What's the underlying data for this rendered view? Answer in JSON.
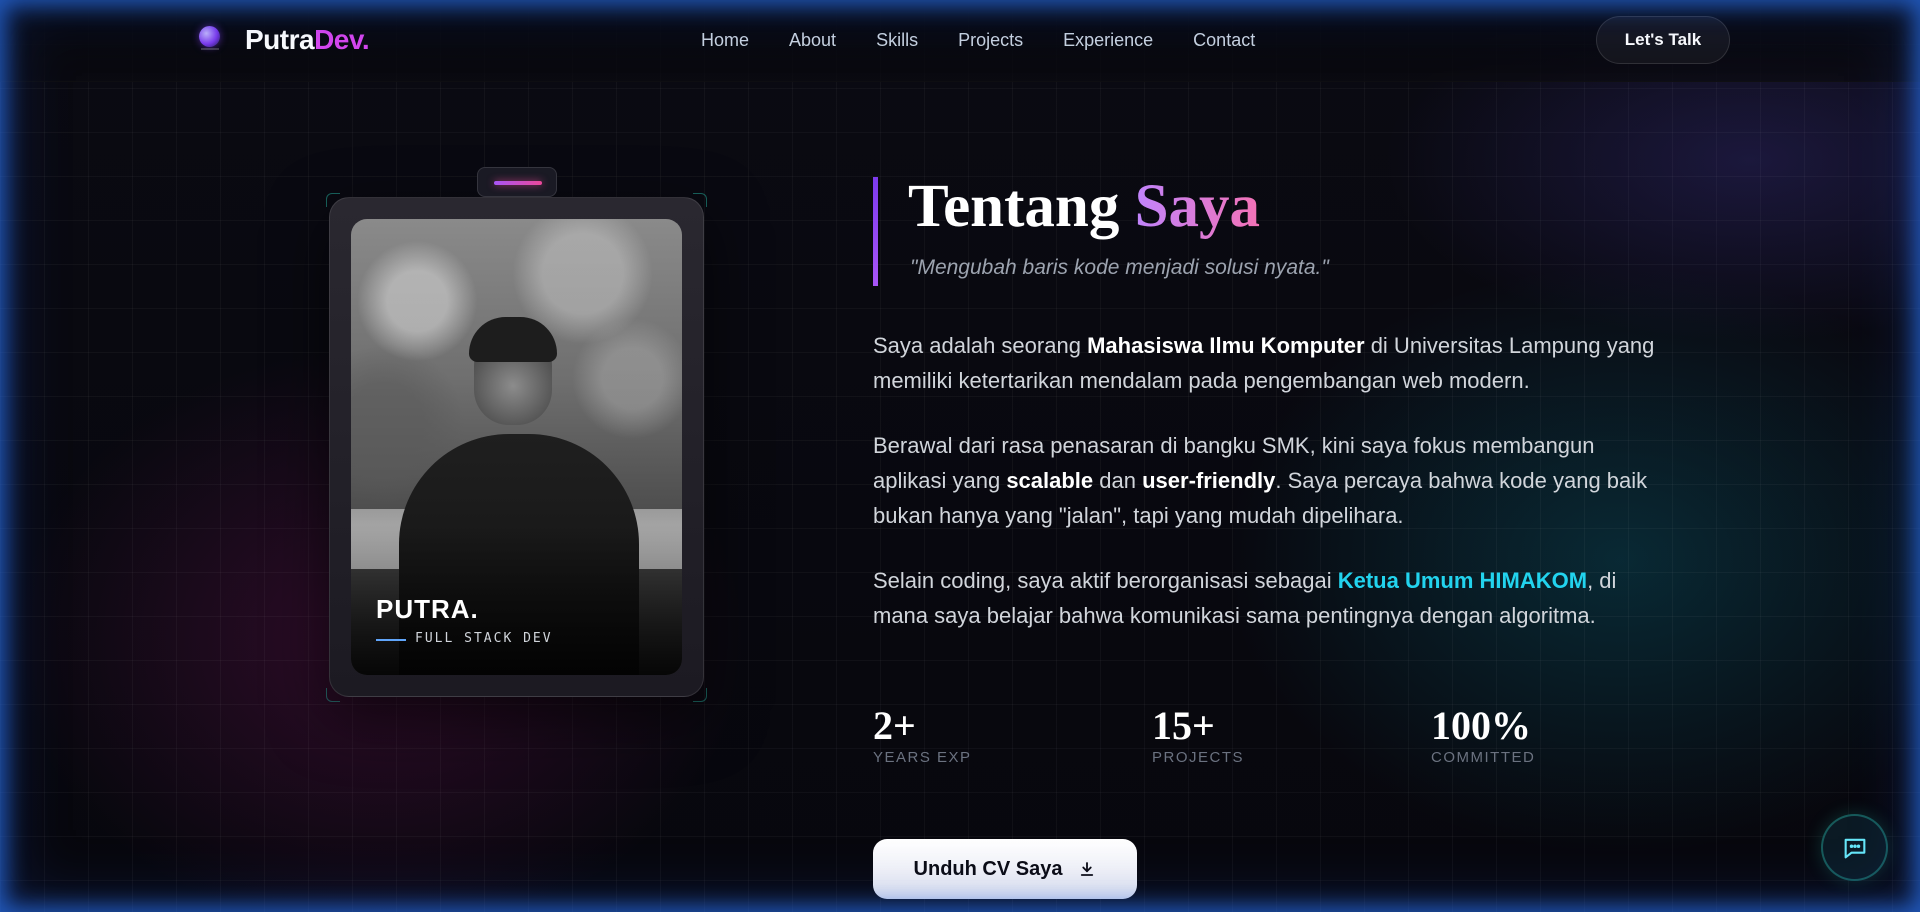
{
  "nav": {
    "brand_main": "Putra",
    "brand_accent": "Dev.",
    "links": [
      "Home",
      "About",
      "Skills",
      "Projects",
      "Experience",
      "Contact"
    ],
    "cta": "Let's Talk"
  },
  "card": {
    "name": "PUTRA.",
    "role": "FULL STACK DEV"
  },
  "about": {
    "title_main": "Tentang",
    "title_accent": "Saya",
    "tagline": "\"Mengubah baris kode menjadi solusi nyata.\"",
    "p1_a": "Saya adalah seorang ",
    "p1_b": "Mahasiswa Ilmu Komputer",
    "p1_c": " di Universitas Lampung yang memiliki ketertarikan mendalam pada pengembangan web modern.",
    "p2_a": "Berawal dari rasa penasaran di bangku SMK, kini saya fokus membangun aplikasi yang ",
    "p2_b": "scalable",
    "p2_c": " dan ",
    "p2_d": "user-friendly",
    "p2_e": ". Saya percaya bahwa kode yang baik bukan hanya yang \"jalan\", tapi yang mudah dipelihara.",
    "p3_a": "Selain coding, saya aktif berorganisasi sebagai ",
    "p3_b": "Ketua Umum HIMAKOM",
    "p3_c": ", di mana saya belajar bahwa komunikasi sama pentingnya dengan algoritma."
  },
  "stats": [
    {
      "value": "2+",
      "label": "YEARS EXP"
    },
    {
      "value": "15+",
      "label": "PROJECTS"
    },
    {
      "value": "100%",
      "label": "COMMITTED"
    }
  ],
  "cv_button": "Unduh CV Saya",
  "icons": {
    "download": "download-icon",
    "chat": "chat-icon",
    "logo": "logo-orb-icon"
  },
  "colors": {
    "accent_purple": "#a855f7",
    "accent_pink": "#d946ef",
    "accent_cyan": "#22d3ee",
    "frame_glow": "#2870e6"
  }
}
